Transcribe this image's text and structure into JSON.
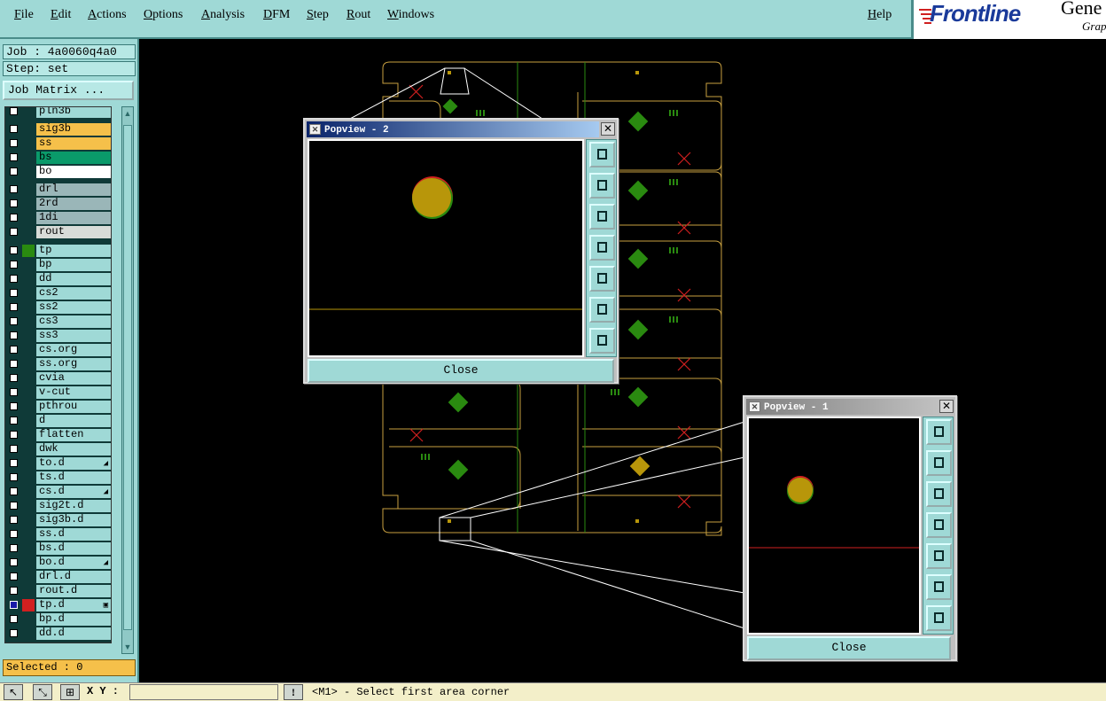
{
  "menu": {
    "items": [
      "File",
      "Edit",
      "Actions",
      "Options",
      "Analysis",
      "DFM",
      "Step",
      "Rout",
      "Windows"
    ],
    "help": "Help"
  },
  "logo": {
    "brand": "Frontline",
    "product": "Gene",
    "sub": "Grap"
  },
  "job": {
    "label": "Job : 4a0060q4a0",
    "step": "Step: set",
    "matrix_button": "Job Matrix ..."
  },
  "layers": [
    {
      "name": "pln3b",
      "color": "",
      "checked": false
    },
    {
      "name": "sig3b",
      "color": "#f5c04a",
      "checked": false
    },
    {
      "name": "ss",
      "color": "#f5c04a",
      "checked": false
    },
    {
      "name": "bs",
      "color": "#0a9a6a",
      "checked": false
    },
    {
      "name": "bo",
      "color": "#ffffff",
      "checked": false
    },
    {
      "name": "drl",
      "color": "#9ab6b8",
      "checked": false
    },
    {
      "name": "2rd",
      "color": "#9ab6b8",
      "checked": false
    },
    {
      "name": "1di",
      "color": "#9ab6b8",
      "checked": false
    },
    {
      "name": "rout",
      "color": "#d8dcd8",
      "checked": false
    },
    {
      "name": "tp",
      "color": "",
      "checked": false
    },
    {
      "name": "bp",
      "color": "",
      "checked": false
    },
    {
      "name": "dd",
      "color": "",
      "checked": false
    },
    {
      "name": "cs2",
      "color": "",
      "checked": false
    },
    {
      "name": "ss2",
      "color": "",
      "checked": false
    },
    {
      "name": "cs3",
      "color": "",
      "checked": false
    },
    {
      "name": "ss3",
      "color": "",
      "checked": false
    },
    {
      "name": "cs.org",
      "color": "",
      "checked": false
    },
    {
      "name": "ss.org",
      "color": "",
      "checked": false
    },
    {
      "name": "cvia",
      "color": "",
      "checked": false
    },
    {
      "name": "v-cut",
      "color": "",
      "checked": false
    },
    {
      "name": "pthrou",
      "color": "",
      "checked": false
    },
    {
      "name": "d",
      "color": "",
      "checked": false
    },
    {
      "name": "flatten",
      "color": "",
      "checked": false
    },
    {
      "name": "dwk",
      "color": "",
      "checked": false
    },
    {
      "name": "to.d",
      "color": "",
      "checked": false,
      "mark": "◢"
    },
    {
      "name": "ts.d",
      "color": "",
      "checked": false
    },
    {
      "name": "cs.d",
      "color": "",
      "checked": false,
      "mark": "◢"
    },
    {
      "name": "sig2t.d",
      "color": "",
      "checked": false
    },
    {
      "name": "sig3b.d",
      "color": "",
      "checked": false
    },
    {
      "name": "ss.d",
      "color": "",
      "checked": false
    },
    {
      "name": "bs.d",
      "color": "",
      "checked": false
    },
    {
      "name": "bo.d",
      "color": "",
      "checked": false,
      "mark": "◢"
    },
    {
      "name": "drl.d",
      "color": "",
      "checked": false
    },
    {
      "name": "rout.d",
      "color": "",
      "checked": false
    },
    {
      "name": "tp.d",
      "color": "",
      "checked": true,
      "mark": "▣"
    },
    {
      "name": "bp.d",
      "color": "",
      "checked": false
    },
    {
      "name": "dd.d",
      "color": "",
      "checked": false
    }
  ],
  "selected": "Selected : 0",
  "status": {
    "xy_label": "X Y :",
    "xy_value": "",
    "message": "<M1> - Select first area corner"
  },
  "popup2": {
    "title": "Popview - 2",
    "close": "Close"
  },
  "popup1": {
    "title": "Popview - 1",
    "close": "Close"
  },
  "popup_tools": [
    "zoom-home-icon",
    "pan-up-icon",
    "pan-down-icon",
    "pan-left-icon",
    "pan-right-icon",
    "zoom-in-icon",
    "zoom-out-icon"
  ],
  "colors": {
    "panel": "#9fd9d6",
    "board_outline": "#c8a040",
    "pad": "#b8960a",
    "green_part": "#2a8a10"
  }
}
